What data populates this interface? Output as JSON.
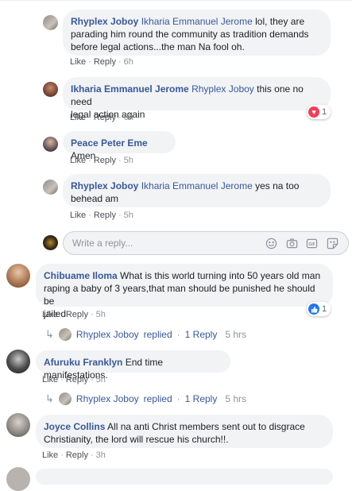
{
  "comments": [
    {
      "author": "Rhyplex Joboy",
      "mention": "Ikharia Emmanuel Jerome",
      "text1": " lol, they are",
      "text2": "parading him round the community as tradition demands",
      "text3": "before legal actions...the man Na fool oh.",
      "like": "Like",
      "reply": "Reply",
      "time": "6h"
    },
    {
      "author": "Ikharia Emmanuel Jerome",
      "mention": "Rhyplex Joboy",
      "text1": " this one no need",
      "text2": "legal action again",
      "like": "Like",
      "reply": "Reply",
      "time": "6h",
      "reaction_count": "1"
    },
    {
      "author": "Peace Peter Eme",
      "text1": " Amen",
      "like": "Like",
      "reply": "Reply",
      "time": "5h"
    },
    {
      "author": "Rhyplex Joboy",
      "mention": "Ikharia Emmanuel Jerome",
      "text1": " yes na too",
      "text2": "behead am",
      "like": "Like",
      "reply": "Reply",
      "time": "5h"
    },
    {
      "author": "Chibuame Iloma",
      "text1": " What is this world turning into 50 years old man",
      "text2": "raping a baby of 3 years,that man should be punished he should be",
      "text3": "jailed",
      "like": "Like",
      "reply": "Reply",
      "time": "5h",
      "reaction_count": "1"
    },
    {
      "author": "Afuruku Franklyn",
      "text1": " End time manifestations.",
      "like": "Like",
      "reply": "Reply",
      "time": "5h"
    },
    {
      "author": "Joyce Collins",
      "text1": " All na anti Christ members sent out to disgrace",
      "text2": "Christianity, the lord will rescue his church!!.",
      "like": "Like",
      "reply": "Reply",
      "time": "3h"
    }
  ],
  "replies_summary": [
    {
      "name": "Rhyplex Joboy",
      "replied": "replied",
      "dot": "·",
      "count": "1 Reply",
      "time": "5 hrs"
    },
    {
      "name": "Rhyplex Joboy",
      "replied": "replied",
      "dot": "·",
      "count": "1 Reply",
      "time": "5 hrs"
    }
  ],
  "reply_input": {
    "placeholder": "Write a reply..."
  },
  "colors": {
    "link": "#385898",
    "bubble": "#f2f3f5",
    "muted": "#90949c",
    "like_blue": "#2078f4",
    "love_red": "#f33e58"
  },
  "icons": [
    "emoji-icon",
    "camera-icon",
    "gif-icon",
    "sticker-icon",
    "like-reaction-icon",
    "love-reaction-icon",
    "reply-arrow-icon"
  ]
}
